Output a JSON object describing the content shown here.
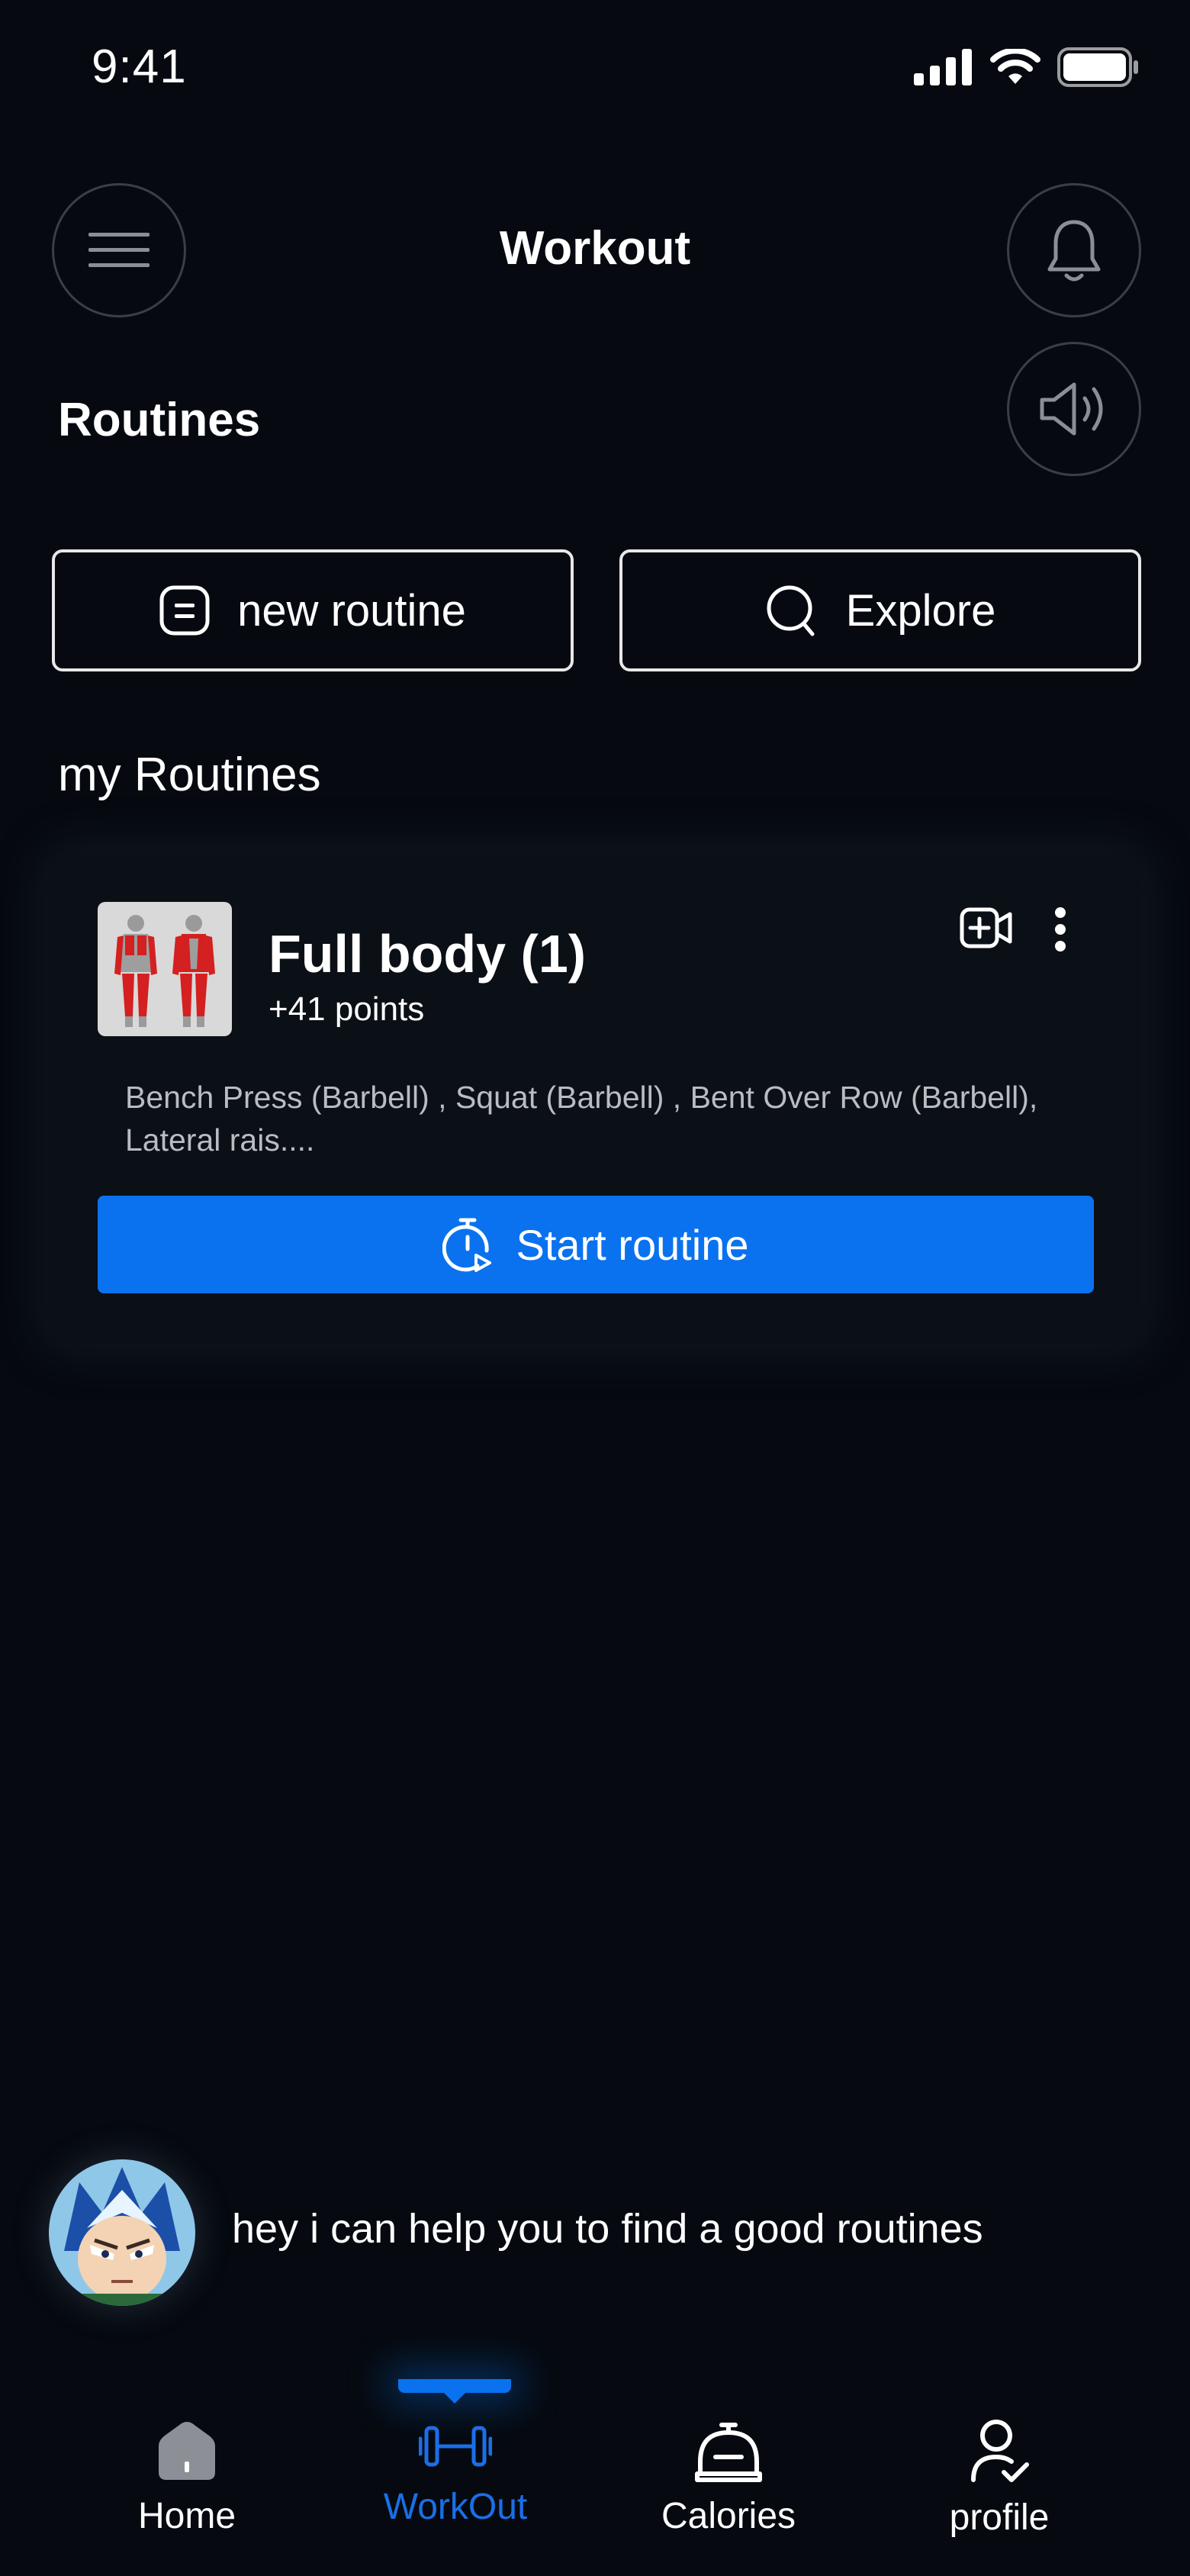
{
  "status_bar": {
    "time": "9:41",
    "icons": [
      "signal-icon",
      "wifi-icon",
      "battery-icon"
    ]
  },
  "header": {
    "title": "Workout",
    "menu_icon": "hamburger-icon",
    "notification_icon": "bell-icon",
    "sound_icon": "speaker-icon"
  },
  "routines": {
    "section_title": "Routines",
    "new_routine_label": "new routine",
    "explore_label": "Explore"
  },
  "my_routines": {
    "title": "my Routines",
    "items": [
      {
        "name": "Full body (1)",
        "points": "+41 points",
        "description": "Bench Press (Barbell) , Squat (Barbell) , Bent Over Row (Barbell), Lateral rais....",
        "start_label": "Start routine"
      }
    ]
  },
  "assistant": {
    "message": "hey i can help you to find a good routines"
  },
  "bottom_nav": {
    "active": "WorkOut",
    "items": [
      {
        "label": "Home",
        "icon": "home-icon"
      },
      {
        "label": "WorkOut",
        "icon": "dumbbell-icon"
      },
      {
        "label": "Calories",
        "icon": "bell-jar-icon"
      },
      {
        "label": "profile",
        "icon": "profile-icon"
      }
    ]
  },
  "colors": {
    "background": "#060a10",
    "card": "#0b0f16",
    "accent": "#0a72ee",
    "active_nav": "#1a6fe8"
  }
}
